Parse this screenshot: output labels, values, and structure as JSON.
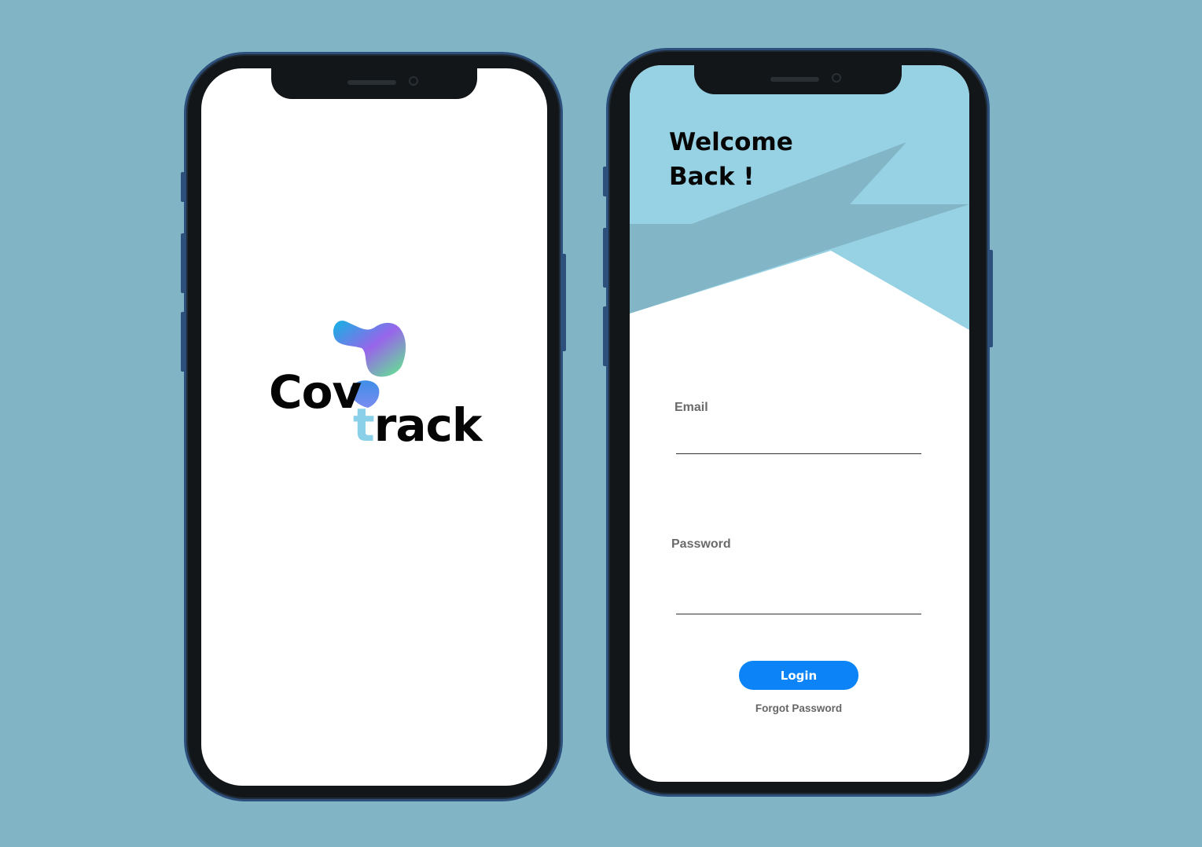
{
  "colors": {
    "background": "#81b5c6",
    "phone_frame": "#131618",
    "phone_border": "#2d4f7c",
    "header_light": "#96d1e4",
    "header_dark": "#82b5c5",
    "button": "#0c84f7",
    "logo_t": "#89d0e8"
  },
  "splash": {
    "logo_part_1": "Cov",
    "logo_t": "t",
    "logo_part_2": "rack"
  },
  "login": {
    "title": "Welcome\nBack !",
    "email_label": "Email",
    "password_label": "Password",
    "login_button": "Login",
    "forgot_password": "Forgot Password"
  },
  "icons": [
    "camera-icon",
    "speaker-grille-icon",
    "logo-blob-icon"
  ]
}
